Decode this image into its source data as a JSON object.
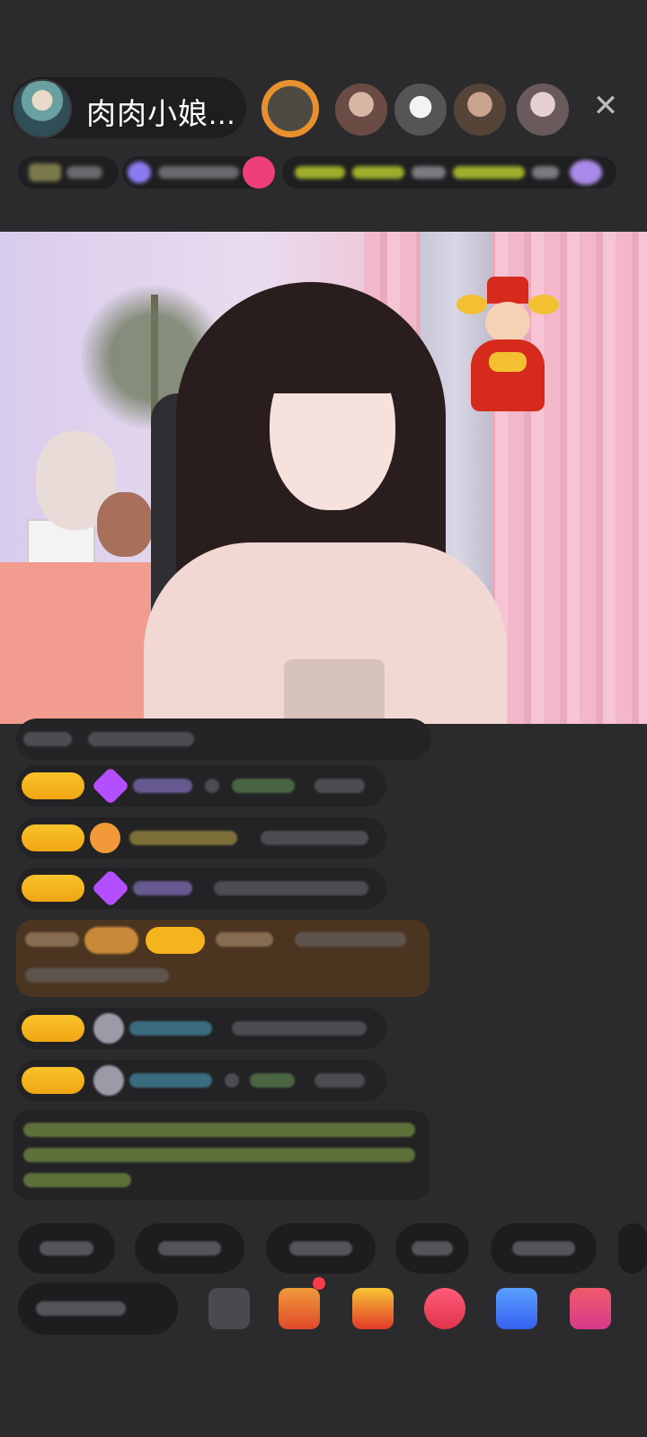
{
  "host": {
    "name": "肉肉小娘..."
  },
  "header": {
    "close_label": "✕"
  },
  "icons": {
    "close": "close-icon",
    "avatar": "host-avatar"
  },
  "colors": {
    "background": "#2b2b2d",
    "badge": "#f5b41d",
    "purple_gem": "#b44fff",
    "orange_gem": "#f29a3a",
    "highlight_message": "#5a3d1f"
  }
}
